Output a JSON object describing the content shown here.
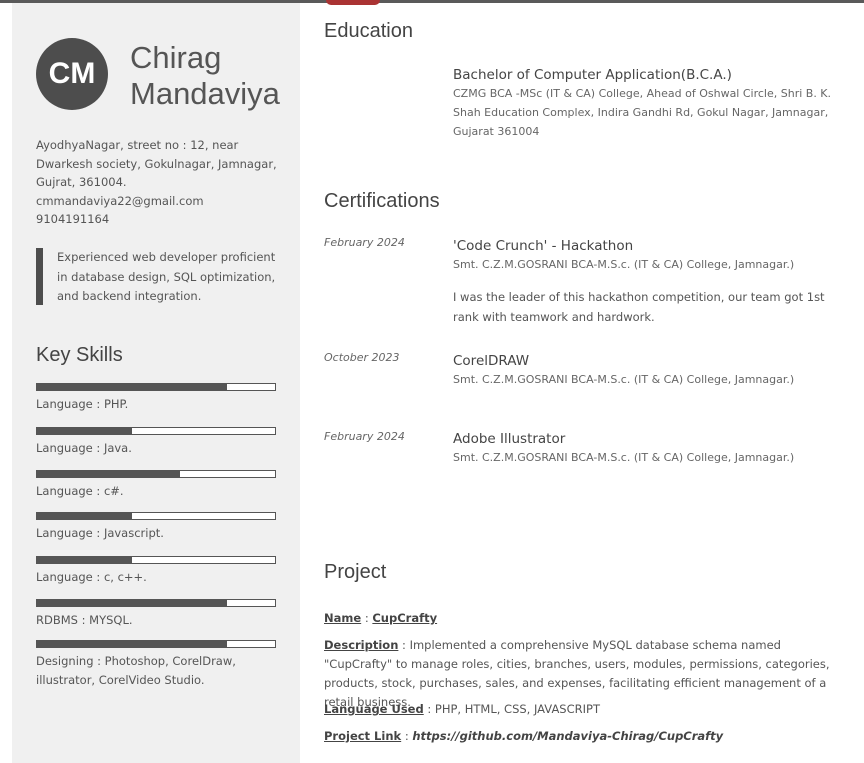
{
  "profile": {
    "initials": "CM",
    "first_name": "Chirag",
    "last_name": "Mandaviya",
    "address": "AyodhyaNagar, street no : 12, near\nDwarkesh society, Gokulnagar, Jamnagar,\nGujrat, 361004.",
    "email": "cmmandaviya22@gmail.com",
    "phone": "9104191164",
    "summary": "Experienced web developer proficient in database design, SQL optimization, and backend integration."
  },
  "skills": {
    "title": "Key Skills",
    "items": [
      {
        "label": "Language : PHP.",
        "level": 0.8
      },
      {
        "label": "Language : Java.",
        "level": 0.4
      },
      {
        "label": "Language : c#.",
        "level": 0.6
      },
      {
        "label": "Language : Javascript.",
        "level": 0.4
      },
      {
        "label": "Language : c, c++.",
        "level": 0.4
      },
      {
        "label": "RDBMS : MYSQL.",
        "level": 0.8
      },
      {
        "label": "Designing : Photoshop, CorelDraw, illustrator, CorelVideo Studio.",
        "level": 0.8
      }
    ]
  },
  "education": {
    "title": "Education",
    "degree": "Bachelor of Computer Application(B.C.A.)",
    "institution": "CZMG BCA -MSc (IT & CA) College, Ahead of Oshwal Circle, Shri B. K. Shah Education Complex, Indira Gandhi Rd, Gokul Nagar, Jamnagar, Gujarat 361004"
  },
  "certifications": {
    "title": "Certifications",
    "items": [
      {
        "date": "February 2024",
        "name": "'Code Crunch' - Hackathon",
        "issuer": "Smt. C.Z.M.GOSRANI BCA-M.S.c. (IT & CA) College, Jamnagar.)",
        "description": "I was the leader of this hackathon competition, our team got 1st rank with teamwork and hardwork."
      },
      {
        "date": "October 2023",
        "name": "CorelDRAW",
        "issuer": "Smt. C.Z.M.GOSRANI BCA-M.S.c. (IT & CA) College, Jamnagar.)"
      },
      {
        "date": "February 2024",
        "name": "Adobe Illustrator",
        "issuer": "Smt. C.Z.M.GOSRANI BCA-M.S.c. (IT & CA) College, Jamnagar.)"
      }
    ]
  },
  "project": {
    "title": "Project",
    "name_label": "Name",
    "name": "CupCrafty",
    "description_label": "Description",
    "description": "Implemented a comprehensive MySQL database schema named \"CupCrafty\" to manage roles, cities, branches, users, modules, permissions, categories, products, stock, purchases, sales, and expenses, facilitating efficient management of a retail business.",
    "language_label": "Language Used",
    "language": "PHP, HTML, CSS, JAVASCRIPT",
    "link_label": "Project Link",
    "link": "https://github.com/Mandaviya-Chirag/CupCrafty"
  }
}
